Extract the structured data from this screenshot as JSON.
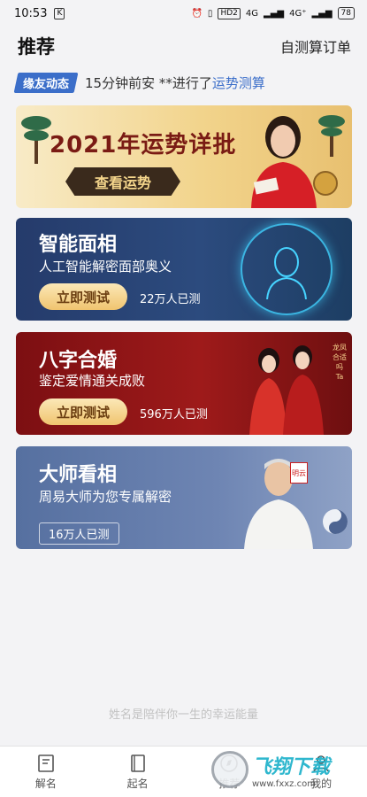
{
  "status_bar": {
    "time": "10:53",
    "signal": "4G",
    "hd": "HD2",
    "signal2": "4G⁺",
    "battery": "78"
  },
  "header": {
    "title": "推荐",
    "link": "自测算订单"
  },
  "ticker": {
    "tag": "缘友动态",
    "text": "15分钟前安 **进行了",
    "link": "运势测算"
  },
  "cards": {
    "fortune": {
      "title": "2021年运势详批",
      "button": "查看运势"
    },
    "face": {
      "title": "智能面相",
      "subtitle": "人工智能解密面部奥义",
      "button": "立即测试",
      "count": "22万人已测"
    },
    "marriage": {
      "title": "八字合婚",
      "subtitle": "鉴定爱情通关成败",
      "button": "立即测试",
      "count": "596万人已测",
      "seal": "龙凤合适吗Ta"
    },
    "master": {
      "title": "大师看相",
      "subtitle": "周易大师为您专属解密",
      "badge": "16万人已测",
      "stamp": "明云"
    }
  },
  "slogan": "姓名是陪伴你一生的幸运能量",
  "tabbar": {
    "tabs": [
      {
        "label": "解名"
      },
      {
        "label": "起名"
      },
      {
        "label": "推荐"
      },
      {
        "label": "我的"
      }
    ]
  },
  "watermark": {
    "big": "飞翔下载",
    "small": "www.fxxz.com"
  },
  "colors": {
    "accent": "#3b6ec9",
    "button_gold": "#f0c46f"
  }
}
